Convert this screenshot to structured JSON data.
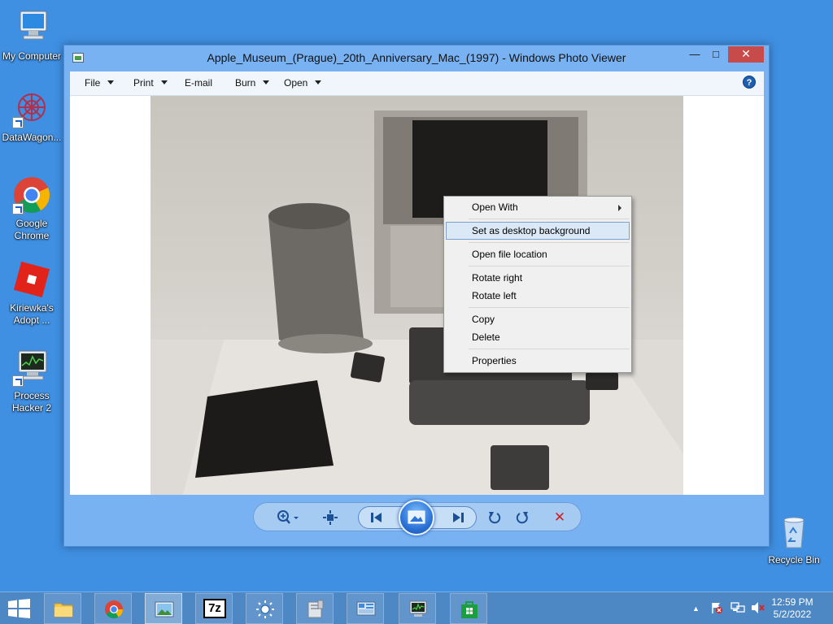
{
  "desktop": {
    "icons": [
      {
        "label_line1": "My Computer",
        "label_line2": ""
      },
      {
        "label_line1": "DataWagon...",
        "label_line2": ""
      },
      {
        "label_line1": "Google",
        "label_line2": "Chrome"
      },
      {
        "label_line1": "Kiriewka's",
        "label_line2": "Adopt ..."
      },
      {
        "label_line1": "Process",
        "label_line2": "Hacker 2"
      },
      {
        "label_line1": "Recycle Bin",
        "label_line2": ""
      }
    ]
  },
  "window": {
    "title": "Apple_Museum_(Prague)_20th_Anniversary_Mac_(1997) - Windows Photo Viewer",
    "minimize_glyph": "—",
    "maximize_glyph": "□",
    "close_glyph": "✕"
  },
  "menubar": {
    "file": "File",
    "print": "Print",
    "email": "E-mail",
    "burn": "Burn",
    "open": "Open",
    "help_glyph": "?"
  },
  "context_menu": {
    "items": [
      {
        "label": "Open With",
        "has_submenu": true
      },
      {
        "label": "Set as desktop background",
        "highlighted": true
      },
      {
        "label": "Open file location"
      },
      {
        "label": "Rotate right"
      },
      {
        "label": "Rotate left"
      },
      {
        "label": "Copy"
      },
      {
        "label": "Delete"
      },
      {
        "label": "Properties"
      }
    ]
  },
  "controls": {
    "zoom_icon": "zoom-icon",
    "actual_size_icon": "actual-size-icon",
    "previous_icon": "previous-icon",
    "slideshow_icon": "slideshow-icon",
    "next_icon": "next-icon",
    "rotate_left_icon": "rotate-counterclockwise-icon",
    "rotate_right_icon": "rotate-clockwise-icon",
    "delete_glyph": "✕"
  },
  "taskbar": {
    "seven_zip_label": "7z",
    "time": "12:59 PM",
    "date": "5/2/2022"
  },
  "colors": {
    "desktop_bg": "#3f8fe2",
    "window_frame": "#78b2f2",
    "close_button": "#c74b4a",
    "menu_highlight": "#dbe9f7",
    "taskbar": "#4d87c4"
  }
}
